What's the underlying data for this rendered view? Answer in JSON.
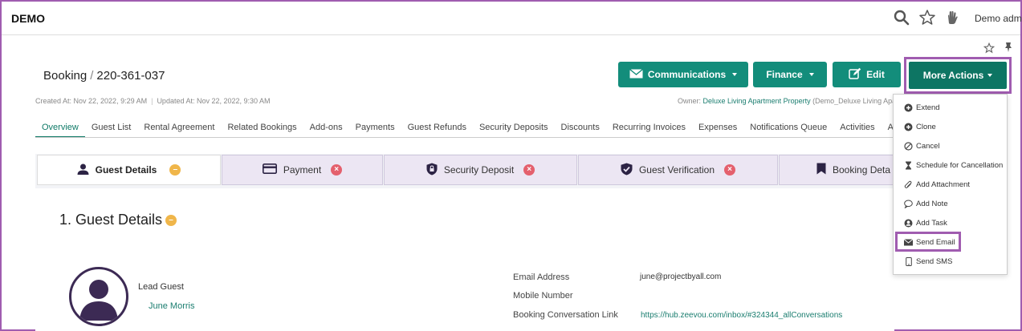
{
  "app": {
    "brand": "DEMO",
    "user_label": "Demo admin"
  },
  "breadcrumb": {
    "section": "Booking",
    "separator": "/",
    "record": "220-361-037"
  },
  "meta": {
    "created": "Created At: Nov 22, 2022, 9:29 AM",
    "updated": "Updated At: Nov 22, 2022, 9:30 AM",
    "owner_prefix": "Owner:",
    "owner_link": "Deluxe Living Apartment Property",
    "owner_suffix": "(Demo_Deluxe Living Apa"
  },
  "actions": {
    "communications": "Communications",
    "finance": "Finance",
    "edit": "Edit",
    "more": "More Actions"
  },
  "tabs": [
    "Overview",
    "Guest List",
    "Rental Agreement",
    "Related Bookings",
    "Add-ons",
    "Payments",
    "Guest Refunds",
    "Security Deposits",
    "Discounts",
    "Recurring Invoices",
    "Expenses",
    "Notifications Queue",
    "Activities",
    "Addition"
  ],
  "steps": {
    "guest_details": "Guest Details",
    "payment": "Payment",
    "security_deposit": "Security Deposit",
    "guest_verification": "Guest Verification",
    "booking_details": "Booking Deta"
  },
  "section": {
    "title": "1. Guest Details"
  },
  "lead": {
    "label": "Lead Guest",
    "name": "June Morris"
  },
  "fields": {
    "email_label": "Email Address",
    "email_value": "june@projectbyall.com",
    "mobile_label": "Mobile Number",
    "link_label": "Booking Conversation Link",
    "link_value": "https://hub.zeevou.com/inbox/#324344_allConversations"
  },
  "menu": {
    "extend": "Extend",
    "clone": "Clone",
    "cancel": "Cancel",
    "schedule_cancel": "Schedule for Cancellation",
    "add_attachment": "Add Attachment",
    "add_note": "Add Note",
    "add_task": "Add Task",
    "send_email": "Send Email",
    "send_sms": "Send SMS"
  },
  "colors": {
    "primary": "#138d7b",
    "primary_dark": "#0d7563",
    "highlight": "#a05cb0",
    "warn": "#f0b64a",
    "error": "#e4606d"
  }
}
